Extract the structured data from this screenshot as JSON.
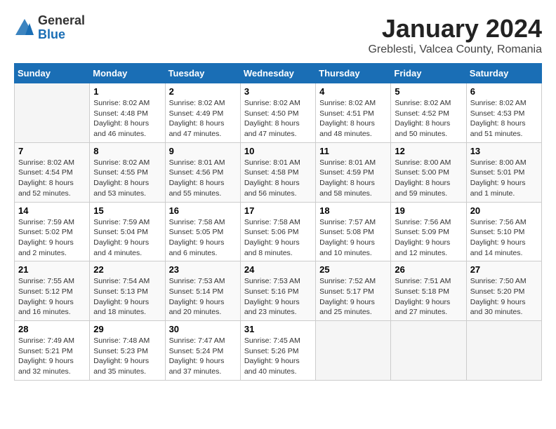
{
  "header": {
    "logo_general": "General",
    "logo_blue": "Blue",
    "title": "January 2024",
    "subtitle": "Greblesti, Valcea County, Romania"
  },
  "weekdays": [
    "Sunday",
    "Monday",
    "Tuesday",
    "Wednesday",
    "Thursday",
    "Friday",
    "Saturday"
  ],
  "weeks": [
    [
      {
        "day": "",
        "info": ""
      },
      {
        "day": "1",
        "info": "Sunrise: 8:02 AM\nSunset: 4:48 PM\nDaylight: 8 hours\nand 46 minutes."
      },
      {
        "day": "2",
        "info": "Sunrise: 8:02 AM\nSunset: 4:49 PM\nDaylight: 8 hours\nand 47 minutes."
      },
      {
        "day": "3",
        "info": "Sunrise: 8:02 AM\nSunset: 4:50 PM\nDaylight: 8 hours\nand 47 minutes."
      },
      {
        "day": "4",
        "info": "Sunrise: 8:02 AM\nSunset: 4:51 PM\nDaylight: 8 hours\nand 48 minutes."
      },
      {
        "day": "5",
        "info": "Sunrise: 8:02 AM\nSunset: 4:52 PM\nDaylight: 8 hours\nand 50 minutes."
      },
      {
        "day": "6",
        "info": "Sunrise: 8:02 AM\nSunset: 4:53 PM\nDaylight: 8 hours\nand 51 minutes."
      }
    ],
    [
      {
        "day": "7",
        "info": "Sunrise: 8:02 AM\nSunset: 4:54 PM\nDaylight: 8 hours\nand 52 minutes."
      },
      {
        "day": "8",
        "info": "Sunrise: 8:02 AM\nSunset: 4:55 PM\nDaylight: 8 hours\nand 53 minutes."
      },
      {
        "day": "9",
        "info": "Sunrise: 8:01 AM\nSunset: 4:56 PM\nDaylight: 8 hours\nand 55 minutes."
      },
      {
        "day": "10",
        "info": "Sunrise: 8:01 AM\nSunset: 4:58 PM\nDaylight: 8 hours\nand 56 minutes."
      },
      {
        "day": "11",
        "info": "Sunrise: 8:01 AM\nSunset: 4:59 PM\nDaylight: 8 hours\nand 58 minutes."
      },
      {
        "day": "12",
        "info": "Sunrise: 8:00 AM\nSunset: 5:00 PM\nDaylight: 8 hours\nand 59 minutes."
      },
      {
        "day": "13",
        "info": "Sunrise: 8:00 AM\nSunset: 5:01 PM\nDaylight: 9 hours\nand 1 minute."
      }
    ],
    [
      {
        "day": "14",
        "info": "Sunrise: 7:59 AM\nSunset: 5:02 PM\nDaylight: 9 hours\nand 2 minutes."
      },
      {
        "day": "15",
        "info": "Sunrise: 7:59 AM\nSunset: 5:04 PM\nDaylight: 9 hours\nand 4 minutes."
      },
      {
        "day": "16",
        "info": "Sunrise: 7:58 AM\nSunset: 5:05 PM\nDaylight: 9 hours\nand 6 minutes."
      },
      {
        "day": "17",
        "info": "Sunrise: 7:58 AM\nSunset: 5:06 PM\nDaylight: 9 hours\nand 8 minutes."
      },
      {
        "day": "18",
        "info": "Sunrise: 7:57 AM\nSunset: 5:08 PM\nDaylight: 9 hours\nand 10 minutes."
      },
      {
        "day": "19",
        "info": "Sunrise: 7:56 AM\nSunset: 5:09 PM\nDaylight: 9 hours\nand 12 minutes."
      },
      {
        "day": "20",
        "info": "Sunrise: 7:56 AM\nSunset: 5:10 PM\nDaylight: 9 hours\nand 14 minutes."
      }
    ],
    [
      {
        "day": "21",
        "info": "Sunrise: 7:55 AM\nSunset: 5:12 PM\nDaylight: 9 hours\nand 16 minutes."
      },
      {
        "day": "22",
        "info": "Sunrise: 7:54 AM\nSunset: 5:13 PM\nDaylight: 9 hours\nand 18 minutes."
      },
      {
        "day": "23",
        "info": "Sunrise: 7:53 AM\nSunset: 5:14 PM\nDaylight: 9 hours\nand 20 minutes."
      },
      {
        "day": "24",
        "info": "Sunrise: 7:53 AM\nSunset: 5:16 PM\nDaylight: 9 hours\nand 23 minutes."
      },
      {
        "day": "25",
        "info": "Sunrise: 7:52 AM\nSunset: 5:17 PM\nDaylight: 9 hours\nand 25 minutes."
      },
      {
        "day": "26",
        "info": "Sunrise: 7:51 AM\nSunset: 5:18 PM\nDaylight: 9 hours\nand 27 minutes."
      },
      {
        "day": "27",
        "info": "Sunrise: 7:50 AM\nSunset: 5:20 PM\nDaylight: 9 hours\nand 30 minutes."
      }
    ],
    [
      {
        "day": "28",
        "info": "Sunrise: 7:49 AM\nSunset: 5:21 PM\nDaylight: 9 hours\nand 32 minutes."
      },
      {
        "day": "29",
        "info": "Sunrise: 7:48 AM\nSunset: 5:23 PM\nDaylight: 9 hours\nand 35 minutes."
      },
      {
        "day": "30",
        "info": "Sunrise: 7:47 AM\nSunset: 5:24 PM\nDaylight: 9 hours\nand 37 minutes."
      },
      {
        "day": "31",
        "info": "Sunrise: 7:45 AM\nSunset: 5:26 PM\nDaylight: 9 hours\nand 40 minutes."
      },
      {
        "day": "",
        "info": ""
      },
      {
        "day": "",
        "info": ""
      },
      {
        "day": "",
        "info": ""
      }
    ]
  ]
}
